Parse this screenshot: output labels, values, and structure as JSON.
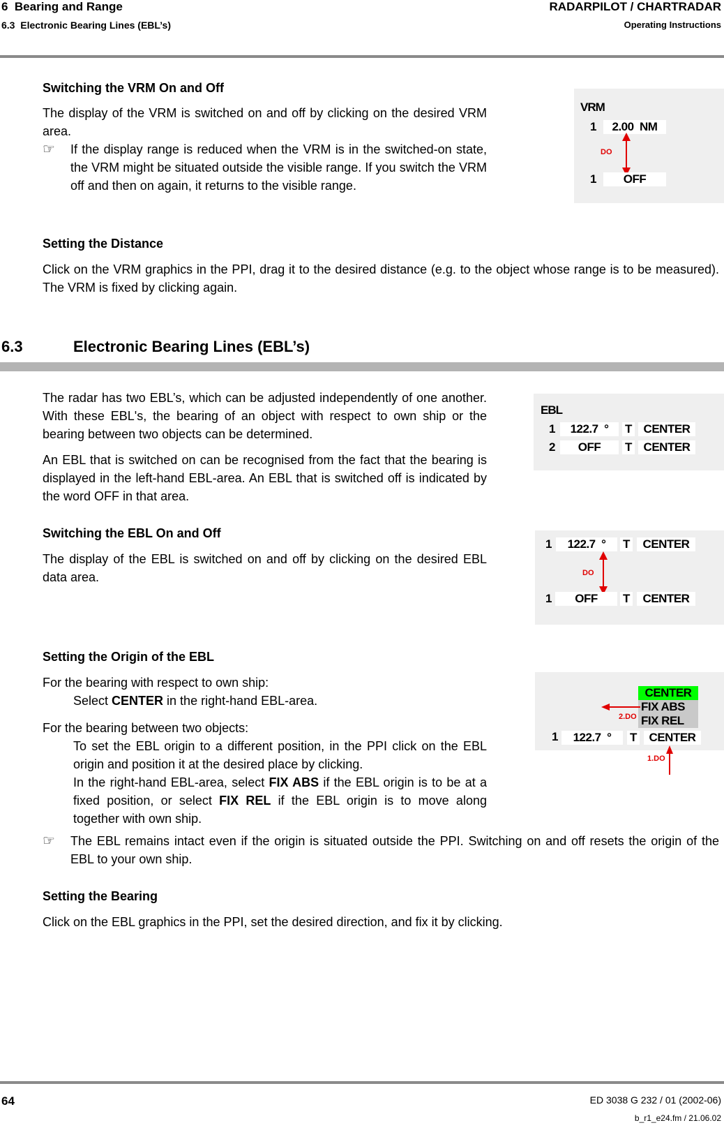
{
  "header": {
    "chapter": "6  Bearing and Range",
    "section": "6.3  Electronic Bearing Lines (EBL’s)",
    "product": "RADARPILOT / CHARTRADAR",
    "doc_type": "Operating Instructions"
  },
  "vrm_switch": {
    "heading": "Switching the VRM On and Off",
    "text": "The display of the VRM is switched on and off by clicking on the desired VRM area.",
    "note": "If the display range is reduced when the VRM is in the switched-on state, the VRM might be situated outside the visible range. If you switch the VRM off and then on again, it returns to the visible range."
  },
  "vrm_distance": {
    "heading": "Setting the Distance",
    "text": "Click on the VRM graphics in the PPI, drag it to the desired distance (e.g. to the object whose range is to be measured). The VRM is fixed by clicking again."
  },
  "vrm_panel": {
    "title": "VRM",
    "row_on": {
      "index": "1",
      "value": "2.00  NM"
    },
    "row_off": {
      "index": "1",
      "value": "OFF"
    },
    "arrow_label": "DO"
  },
  "section": {
    "number": "6.3",
    "title": "Electronic Bearing Lines (EBL’s)"
  },
  "ebl_intro": {
    "p1": "The radar has two EBL’s, which can be adjusted independently of one another. With these EBL's, the bearing of an object with respect to own ship or the bearing between two objects can be determined.",
    "p2": "An EBL that is switched on can be recognised from the fact that the bearing is displayed in the left-hand EBL-area. An EBL that is switched off is indicated by the word OFF in that area."
  },
  "ebl_panel": {
    "title": "EBL",
    "rows": [
      {
        "index": "1",
        "bearing": "122.7  °",
        "ref": "T",
        "origin": "CENTER"
      },
      {
        "index": "2",
        "bearing": "OFF",
        "ref": "T",
        "origin": "CENTER"
      }
    ]
  },
  "ebl_switch": {
    "heading": "Switching the EBL On and Off",
    "text": "The display of the EBL is switched on and off by clicking on the desired EBL data area."
  },
  "ebl_switch_panel": {
    "row_on": {
      "index": "1",
      "bearing": "122.7  °",
      "ref": "T",
      "origin": "CENTER"
    },
    "row_off": {
      "index": "1",
      "bearing": "OFF",
      "ref": "T",
      "origin": "CENTER"
    },
    "arrow_label": "DO"
  },
  "ebl_origin": {
    "heading": "Setting the Origin of the EBL",
    "own_ship_label": "For the bearing with respect to own ship:",
    "own_ship_pre": "Select ",
    "own_ship_bold": "CENTER",
    "own_ship_post": " in the right-hand EBL-area.",
    "two_obj_label": "For the bearing between two objects:",
    "two_obj_text": "To set the EBL origin to a different position, in the PPI click on the EBL origin and position it at the desired place by clicking.",
    "fix_pre": "In the right-hand EBL-area, select ",
    "fix_abs": "FIX ABS",
    "fix_mid": " if the EBL origin is to be at a fixed position, or select ",
    "fix_rel": "FIX REL",
    "fix_post": " if the EBL origin is to move along together with own ship.",
    "note": "The EBL remains intact even if the origin is situated outside the PPI. Switching on and off resets the origin of the EBL to your own ship."
  },
  "origin_panel": {
    "menu": [
      "CENTER",
      "FIX ABS",
      "FIX REL"
    ],
    "selected": "CENTER",
    "highlight_color": "#00ff00",
    "row": {
      "index": "1",
      "bearing": "122.7  °",
      "ref": "T",
      "origin": "CENTER"
    },
    "step1": "1.DO",
    "step2": "2.DO"
  },
  "ebl_bearing": {
    "heading": "Setting the Bearing",
    "text": "Click on the EBL graphics in the PPI, set the desired direction, and fix it by clicking."
  },
  "footer": {
    "page": "64",
    "doc_id": "ED 3038 G 232 / 01 (2002-06)",
    "file": "b_r1_e24.fm / 21.06.02"
  },
  "icons": {
    "note": "☞"
  }
}
